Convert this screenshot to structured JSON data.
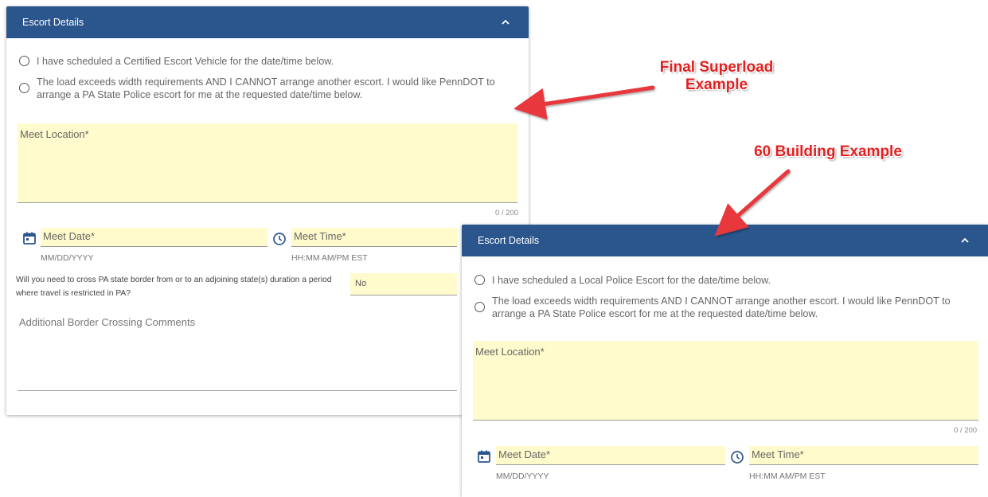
{
  "panel1": {
    "header_title": "Escort Details",
    "radio_options": [
      "I have scheduled a Certified Escort Vehicle for the date/time below.",
      "The load exceeds width requirements AND I CANNOT arrange another escort. I would like PennDOT to arrange a PA State Police escort for me at the requested date/time below."
    ],
    "meet_location_label": "Meet Location*",
    "meet_location_counter": "0 / 200",
    "meet_date_label": "Meet Date*",
    "meet_date_hint": "MM/DD/YYYY",
    "meet_time_label": "Meet Time*",
    "meet_time_hint": "HH:MM AM/PM EST",
    "border_question": "Will you need to cross PA state border from or to an adjoining state(s) duration a period where travel is restricted in PA?",
    "border_answer": "No",
    "comments_label": "Additional Border Crossing Comments"
  },
  "panel2": {
    "header_title": "Escort Details",
    "radio_options": [
      "I have scheduled a Local Police Escort for the date/time below.",
      "The load exceeds width requirements AND I CANNOT arrange another escort. I would like PennDOT to arrange a PA State Police escort for me at the requested date/time below."
    ],
    "meet_location_label": "Meet Location*",
    "meet_location_counter": "0 / 200",
    "meet_date_label": "Meet Date*",
    "meet_date_hint": "MM/DD/YYYY",
    "meet_time_label": "Meet Time*",
    "meet_time_hint": "HH:MM AM/PM EST"
  },
  "annotations": {
    "final_superload_line1": "Final Superload",
    "final_superload_line2": "Example",
    "building_60": "60 Building Example"
  },
  "colors": {
    "header_bg": "#2b568d",
    "field_bg": "#fffbcc",
    "annotation": "#e02020",
    "arrow": "#e8383d"
  }
}
